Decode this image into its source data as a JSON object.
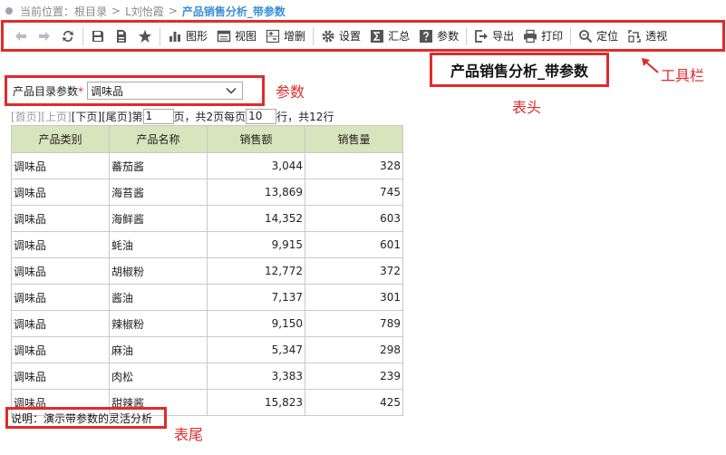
{
  "breadcrumb": {
    "prefix": "当前位置：",
    "root": "根目录",
    "separator": ">",
    "user": "L刘怡霞",
    "current": "产品销售分析_带参数"
  },
  "toolbar": {
    "items": [
      {
        "label": "",
        "icon": "back-arrow-icon"
      },
      {
        "label": "",
        "icon": "forward-arrow-icon"
      },
      {
        "label": "",
        "icon": "refresh-icon"
      },
      {
        "label": "",
        "icon": "save-icon"
      },
      {
        "label": "",
        "icon": "save-as-icon"
      },
      {
        "label": "",
        "icon": "star-icon"
      },
      {
        "label": "图形",
        "icon": "bar-chart-icon"
      },
      {
        "label": "视图",
        "icon": "view-icon"
      },
      {
        "label": "增删",
        "icon": "add-remove-icon"
      },
      {
        "label": "设置",
        "icon": "gear-icon"
      },
      {
        "label": "汇总",
        "icon": "sigma-icon"
      },
      {
        "label": "参数",
        "icon": "help-icon"
      },
      {
        "label": "导出",
        "icon": "export-icon"
      },
      {
        "label": "打印",
        "icon": "print-icon"
      },
      {
        "label": "定位",
        "icon": "search-icon"
      },
      {
        "label": "透视",
        "icon": "pivot-icon"
      }
    ]
  },
  "report": {
    "title": "产品销售分析_带参数",
    "footer_text": "说明：演示带参数的灵活分析"
  },
  "parameter": {
    "label": "产品目录参数",
    "required_mark": "*",
    "selected": "调味品"
  },
  "annotations": {
    "toolbar": "工具栏",
    "parameter": "参数",
    "header": "表头",
    "footer": "表尾"
  },
  "pager": {
    "first": "[首页]",
    "prev": "[上页]",
    "next": "[下页]",
    "last": "[尾页]",
    "page_prefix": "第",
    "page_value": "1",
    "page_suffix": "页，共2页",
    "size_prefix": "每页",
    "size_value": "10",
    "size_suffix": "行，共12行"
  },
  "table": {
    "headers": [
      "产品类别",
      "产品名称",
      "销售额",
      "销售量"
    ],
    "rows": [
      [
        "调味品",
        "蕃茄酱",
        "3,044",
        "328"
      ],
      [
        "调味品",
        "海苔酱",
        "13,869",
        "745"
      ],
      [
        "调味品",
        "海鲜酱",
        "14,352",
        "603"
      ],
      [
        "调味品",
        "蚝油",
        "9,915",
        "601"
      ],
      [
        "调味品",
        "胡椒粉",
        "12,772",
        "372"
      ],
      [
        "调味品",
        "酱油",
        "7,137",
        "301"
      ],
      [
        "调味品",
        "辣椒粉",
        "9,150",
        "789"
      ],
      [
        "调味品",
        "麻油",
        "5,347",
        "298"
      ],
      [
        "调味品",
        "肉松",
        "3,383",
        "239"
      ],
      [
        "调味品",
        "甜辣酱",
        "15,823",
        "425"
      ]
    ]
  },
  "colors": {
    "annotation_red": "#e02b2b",
    "header_bg": "#d8e4bc",
    "breadcrumb_link": "#3a8fd6"
  }
}
